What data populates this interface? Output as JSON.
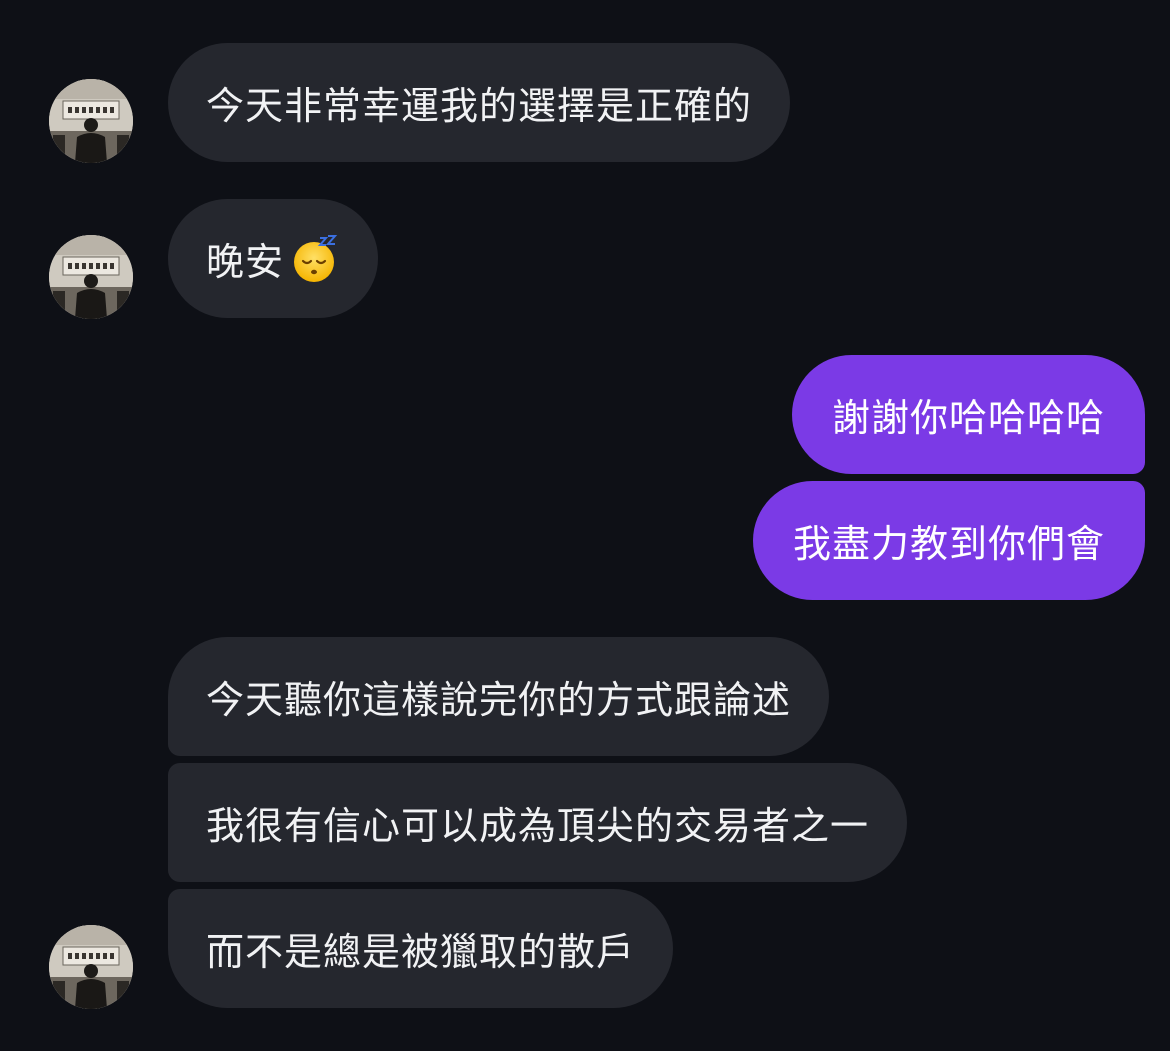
{
  "conversation": {
    "messages": [
      {
        "sender": "them",
        "text": "今天非常幸運我的選擇是正確的"
      },
      {
        "sender": "them",
        "text": "晚安",
        "emoji": "sleeping-face"
      },
      {
        "sender": "me",
        "text": "謝謝你哈哈哈哈"
      },
      {
        "sender": "me",
        "text": "我盡力教到你們會"
      },
      {
        "sender": "them",
        "text": "今天聽你這樣說完你的方式跟論述"
      },
      {
        "sender": "them",
        "text": "我很有信心可以成為頂尖的交易者之一"
      },
      {
        "sender": "them",
        "text": "而不是總是被獵取的散戶"
      }
    ]
  },
  "colors": {
    "background": "#0e1016",
    "incoming_bubble": "#25272e",
    "outgoing_bubble": "#7b3ae6",
    "incoming_text": "#f1f2f4",
    "outgoing_text": "#ffffff"
  },
  "icons": {
    "avatar": "contact-avatar-photo",
    "emoji": "sleeping-face-emoji"
  }
}
